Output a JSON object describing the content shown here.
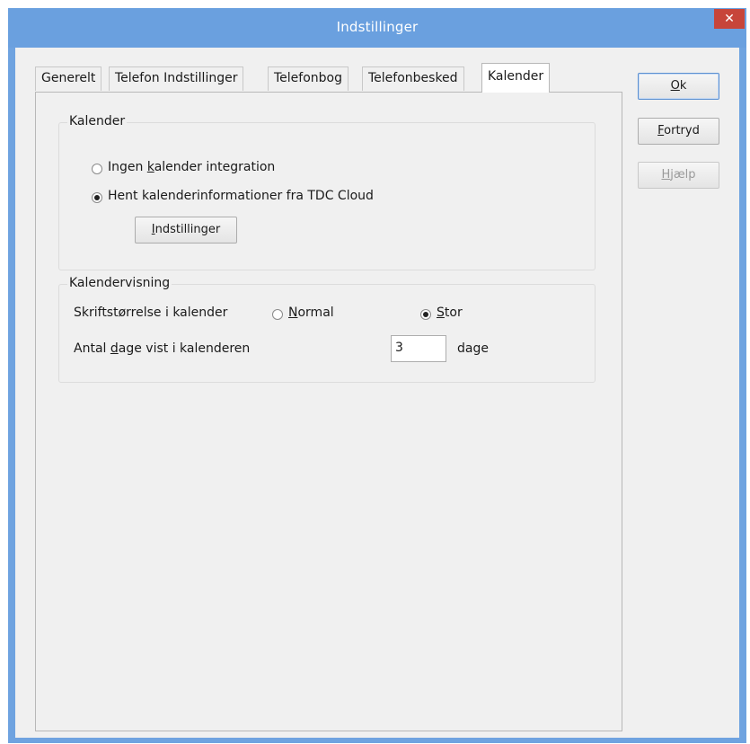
{
  "window": {
    "title": "Indstillinger",
    "close_glyph": "✕"
  },
  "tabs": [
    {
      "label": "Generelt",
      "active": false
    },
    {
      "label": "Telefon Indstillinger",
      "active": false
    },
    {
      "label": "Telefonbog",
      "active": false
    },
    {
      "label": "Telefonbesked",
      "active": false
    },
    {
      "label": "Kalender",
      "active": true
    }
  ],
  "kalender_group": {
    "title": "Kalender",
    "option_none": {
      "pre": "Ingen ",
      "mn": "k",
      "post": "alender integration",
      "selected": false
    },
    "option_cloud": {
      "label": "Hent kalenderinformationer fra TDC Cloud",
      "selected": true
    },
    "settings_button": {
      "mn": "I",
      "post": "ndstillinger"
    }
  },
  "view_group": {
    "title": "Kalendervisning",
    "font_size_label": "Skriftstørrelse i kalender",
    "font_normal": {
      "mn": "N",
      "post": "ormal",
      "selected": false
    },
    "font_large": {
      "mn": "S",
      "post": "tor",
      "selected": true
    },
    "days_label": {
      "pre": "Antal ",
      "mn": "d",
      "post": "age vist i kalenderen"
    },
    "days_value": "3",
    "days_unit": "dage"
  },
  "buttons": {
    "ok": {
      "mn": "O",
      "post": "k"
    },
    "cancel": {
      "mn": "F",
      "post": "ortryd"
    },
    "help": {
      "mn": "H",
      "post": "jælp",
      "enabled": false
    }
  }
}
